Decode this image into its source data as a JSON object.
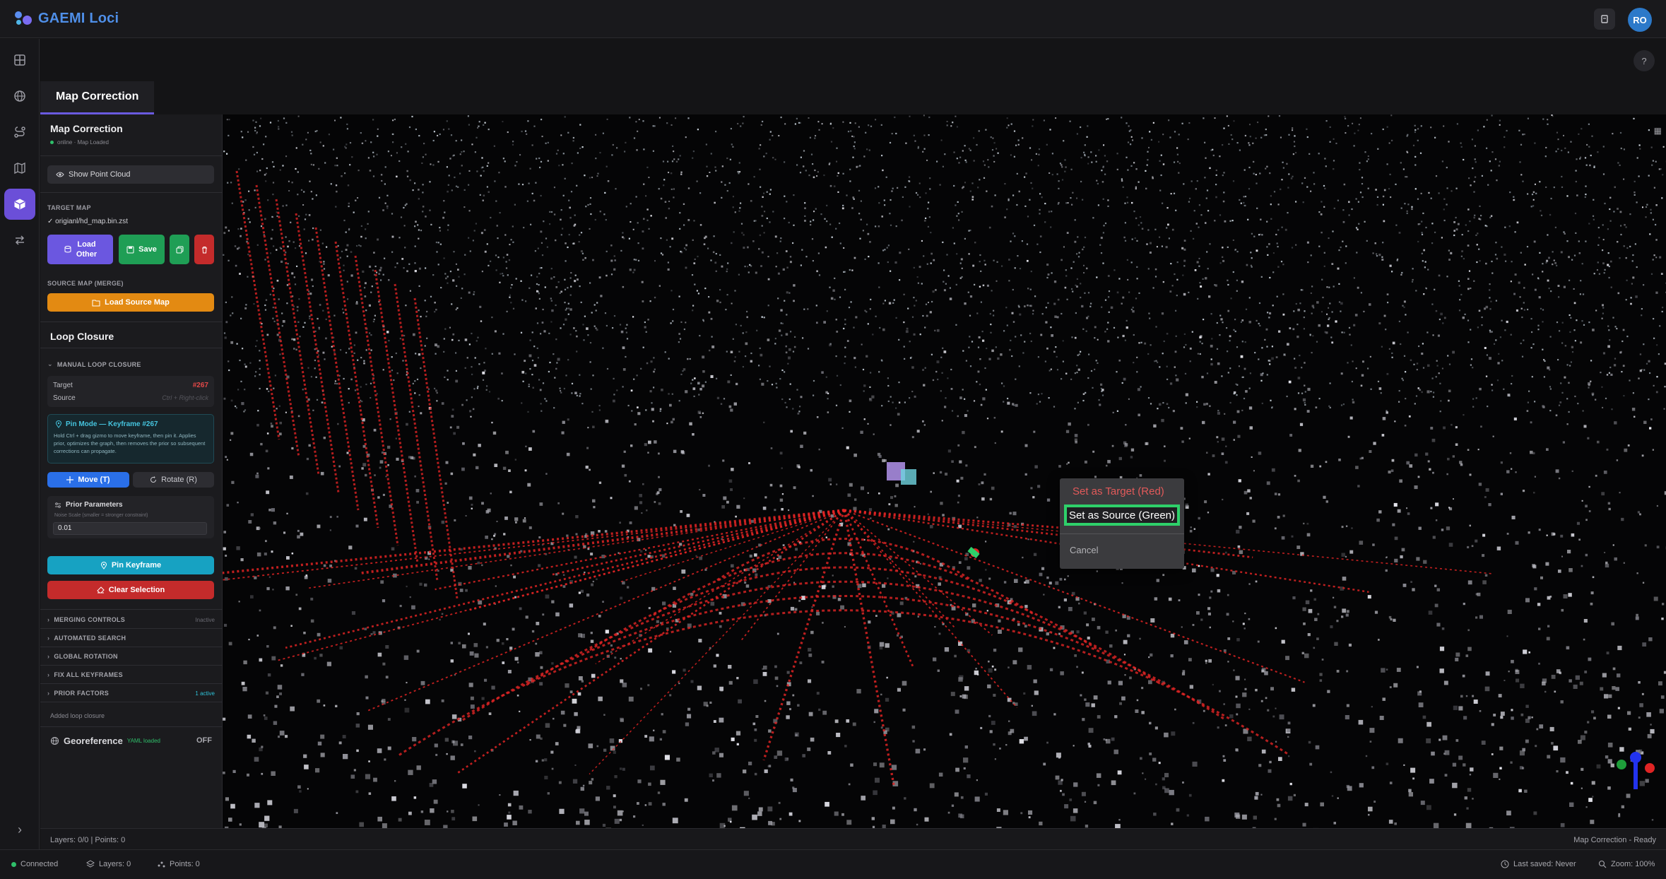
{
  "app": {
    "title": "GAEMI Loci",
    "user_initials": "RO"
  },
  "header": {
    "help_label": "?"
  },
  "tabs": [
    {
      "label": "Map Correction"
    }
  ],
  "panel": {
    "title": "Map Correction",
    "status": "online · Map Loaded",
    "show_point_cloud": "Show Point Cloud",
    "target_map_label": "TARGET MAP",
    "target_map_file": "✓ origianl/hd_map.bin.zst",
    "load_other_line1": "Load",
    "load_other_line2": "Other",
    "save": "Save",
    "source_map_label": "SOURCE MAP (MERGE)",
    "load_source_map": "Load Source Map",
    "loop_closure_title": "Loop Closure",
    "manual_loop_closure": "MANUAL LOOP CLOSURE",
    "target_key": "Target",
    "target_value": "#267",
    "source_key": "Source",
    "source_value": "Ctrl + Right-click",
    "pin_mode_title": "Pin Mode — Keyframe #267",
    "pin_mode_desc": "Hold Ctrl + drag gizmo to move keyframe, then pin it. Applies prior, optimizes the graph, then removes the prior so subsequent corrections can propagate.",
    "move": "Move (T)",
    "rotate": "Rotate (R)",
    "prior_params_title": "Prior Parameters",
    "noise_scale_label": "Noise Scale (smaller = stronger constraint)",
    "noise_scale_value": "0.01",
    "pin_keyframe": "Pin Keyframe",
    "clear_selection": "Clear Selection",
    "merging_controls": "MERGING CONTROLS",
    "merging_controls_badge": "Inactive",
    "automated_search": "AUTOMATED SEARCH",
    "global_rotation": "GLOBAL ROTATION",
    "fix_all_keyframes": "FIX ALL KEYFRAMES",
    "prior_factors": "PRIOR FACTORS",
    "prior_factors_badge": "1 active",
    "log_message": "Added loop closure",
    "georeference": "Georeference",
    "georeference_badge": "YAML loaded",
    "georeference_state": "OFF"
  },
  "context_menu": {
    "set_target": "Set as Target (Red)",
    "set_source": "Set as Source (Green)",
    "cancel": "Cancel"
  },
  "info_bar": {
    "left": "Layers: 0/0 | Points: 0",
    "right": "Map Correction - Ready"
  },
  "statusbar": {
    "connected": "Connected",
    "layers": "Layers: 0",
    "points": "Points: 0",
    "last_saved": "Last saved: Never",
    "zoom": "Zoom: 100%"
  },
  "colors": {
    "accent": "#6b4fd8",
    "brand": "#4f8fe8",
    "target_red": "#e23b3b",
    "source_green": "#2ed06a",
    "orange": "#e38a12",
    "cyan": "#17a2c2",
    "danger": "#c42b2b"
  }
}
